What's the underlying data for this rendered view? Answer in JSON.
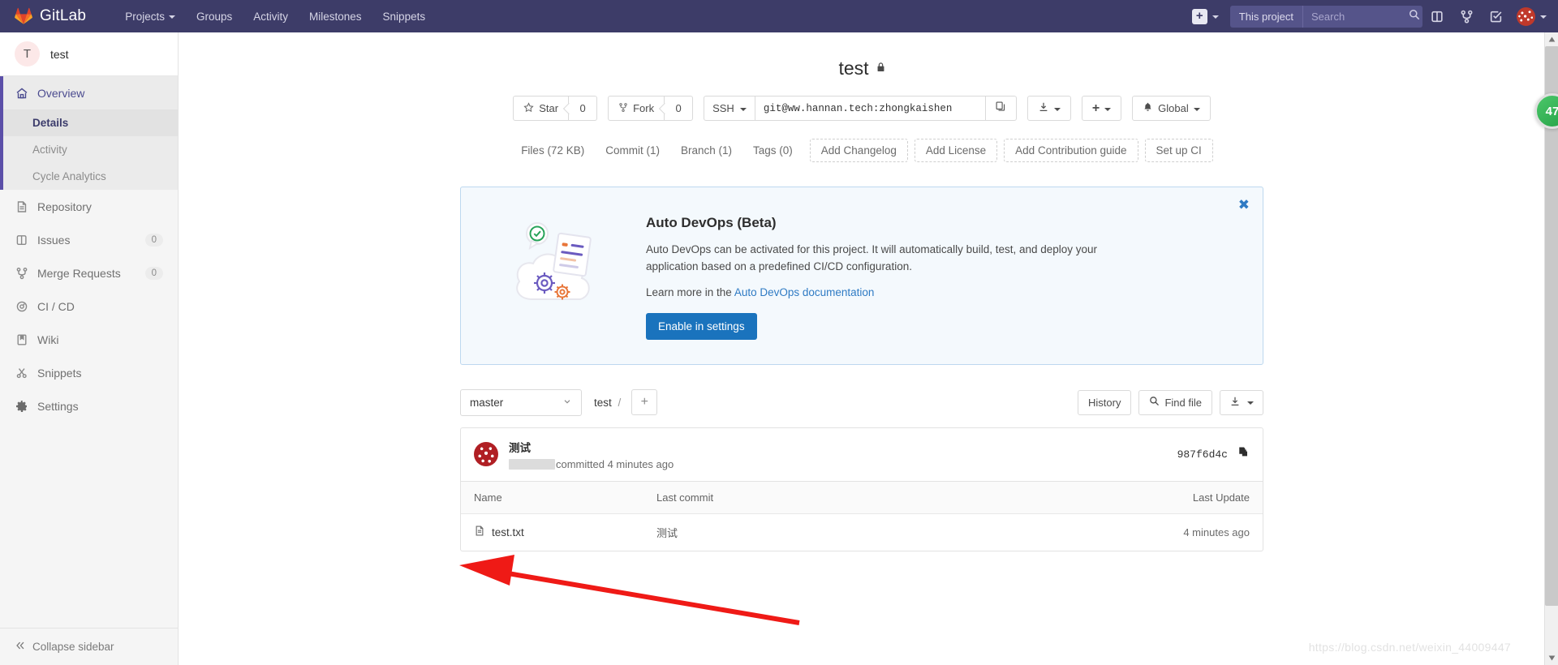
{
  "navbar": {
    "brand": "GitLab",
    "links": [
      {
        "label": "Projects",
        "has_caret": true
      },
      {
        "label": "Groups",
        "has_caret": false
      },
      {
        "label": "Activity",
        "has_caret": false
      },
      {
        "label": "Milestones",
        "has_caret": false
      },
      {
        "label": "Snippets",
        "has_caret": false
      }
    ],
    "plus_label": "+",
    "scope_label": "This project",
    "search_placeholder": "Search",
    "search_value": "",
    "icons": [
      "issues-icon",
      "merge-requests-icon",
      "todos-icon"
    ]
  },
  "sidebar": {
    "project_initial": "T",
    "project_name": "test",
    "items": [
      {
        "label": "Overview",
        "icon": "home-icon",
        "badge": "",
        "active": true
      },
      {
        "label": "Repository",
        "icon": "document-icon",
        "badge": ""
      },
      {
        "label": "Issues",
        "icon": "issues-icon",
        "badge": "0"
      },
      {
        "label": "Merge Requests",
        "icon": "merge-requests-icon",
        "badge": "0"
      },
      {
        "label": "CI / CD",
        "icon": "rocket-icon",
        "badge": ""
      },
      {
        "label": "Wiki",
        "icon": "book-icon",
        "badge": ""
      },
      {
        "label": "Snippets",
        "icon": "scissors-icon",
        "badge": ""
      },
      {
        "label": "Settings",
        "icon": "gear-icon",
        "badge": ""
      }
    ],
    "subitems": [
      {
        "label": "Details",
        "selected": true
      },
      {
        "label": "Activity",
        "selected": false
      },
      {
        "label": "Cycle Analytics",
        "selected": false
      }
    ],
    "collapse_label": "Collapse sidebar"
  },
  "project": {
    "title": "test",
    "visibility": "private",
    "star_label": "Star",
    "star_count": "0",
    "fork_label": "Fork",
    "fork_count": "0",
    "clone_protocol": "SSH",
    "clone_url": "git@ww.hannan.tech:zhongkaishen",
    "notification_label": "Global"
  },
  "tabs": [
    {
      "label": "Files (72 KB)",
      "style": "plain"
    },
    {
      "label": "Commit (1)",
      "style": "plain"
    },
    {
      "label": "Branch (1)",
      "style": "plain"
    },
    {
      "label": "Tags (0)",
      "style": "plain"
    },
    {
      "label": "Add Changelog",
      "style": "dashed"
    },
    {
      "label": "Add License",
      "style": "dashed"
    },
    {
      "label": "Add Contribution guide",
      "style": "dashed"
    },
    {
      "label": "Set up CI",
      "style": "dashed"
    }
  ],
  "devops": {
    "title": "Auto DevOps (Beta)",
    "description": "Auto DevOps can be activated for this project. It will automatically build, test, and deploy your application based on a predefined CI/CD configuration.",
    "learn_prefix": "Learn more in the ",
    "learn_link": "Auto DevOps documentation",
    "button_label": "Enable in settings",
    "close_label": "✖",
    "border_color": "#bdd8ef",
    "bg_color": "#f4f9fd",
    "button_color": "#1a73bd"
  },
  "repo_toolbar": {
    "branch": "master",
    "path_root": "test",
    "path_sep": "/",
    "add_label": "+",
    "history_label": "History",
    "find_file_label": "Find file",
    "download_label": ""
  },
  "commit": {
    "message": "测试",
    "author_redacted": true,
    "meta_text": "committed 4 minutes ago",
    "sha": "987f6d4c"
  },
  "file_table": {
    "headers": [
      "Name",
      "Last commit",
      "Last Update"
    ],
    "rows": [
      {
        "name": "test.txt",
        "icon": "file-icon",
        "last_commit": "测试",
        "last_update": "4 minutes ago"
      }
    ]
  },
  "overlays": {
    "green_badge": "47",
    "watermark": "https://blog.csdn.net/weixin_44009447"
  }
}
